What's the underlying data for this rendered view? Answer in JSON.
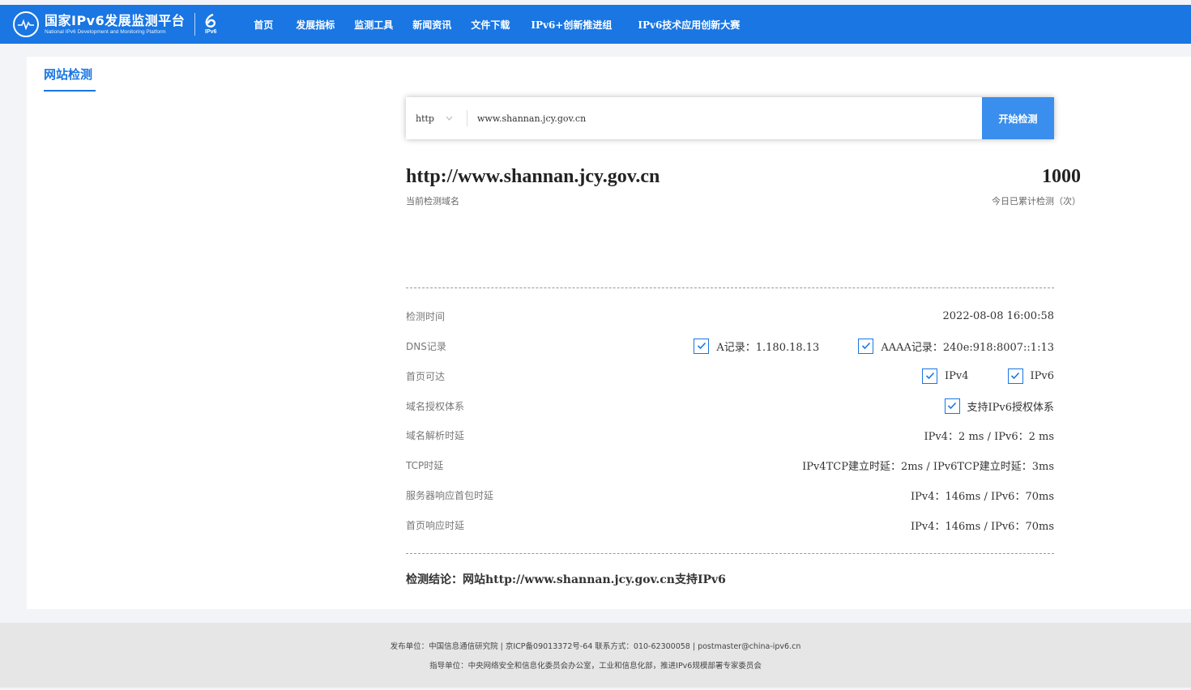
{
  "header": {
    "logo_cn": "国家IPv6发展监测平台",
    "logo_en": "National IPv6 Development and Monitoring Platform",
    "ipv6_mark": "IPv6",
    "nav": [
      "首页",
      "发展指标",
      "监测工具",
      "新闻资讯",
      "文件下载",
      "IPv6+创新推进组",
      "IPv6技术应用创新大赛"
    ]
  },
  "page": {
    "tab_title": "网站检测"
  },
  "search": {
    "protocol": "http",
    "url": "www.shannan.jcy.gov.cn",
    "button": "开始检测"
  },
  "summary": {
    "domain": "http://www.shannan.jcy.gov.cn",
    "domain_caption": "当前检测域名",
    "count": "1000",
    "count_caption": "今日已累计检测（次）"
  },
  "results": {
    "time": {
      "label": "检测时间",
      "value": "2022-08-08 16:00:58"
    },
    "dns": {
      "label": "DNS记录",
      "a": "A记录：1.180.18.13",
      "aaaa": "AAAA记录：240e:918:8007::1:13"
    },
    "reach": {
      "label": "首页可达",
      "ipv4": "IPv4",
      "ipv6": "IPv6"
    },
    "auth": {
      "label": "域名授权体系",
      "value": "支持IPv6授权体系"
    },
    "dns_latency": {
      "label": "域名解析时延",
      "value": "IPv4：2 ms / IPv6：2 ms"
    },
    "tcp": {
      "label": "TCP时延",
      "value": "IPv4TCP建立时延：2ms / IPv6TCP建立时延：3ms"
    },
    "server": {
      "label": "服务器响应首包时延",
      "value": "IPv4：146ms / IPv6：70ms"
    },
    "home": {
      "label": "首页响应时延",
      "value": "IPv4：146ms / IPv6：70ms"
    }
  },
  "conclusion": {
    "prefix": "检测结论：",
    "text": "网站http://www.shannan.jcy.gov.cn支持IPv6"
  },
  "footer": {
    "line1": "发布单位：中国信息通信研究院 | 京ICP备09013372号-64 联系方式：010-62300058 | postmaster@china-ipv6.cn",
    "line2": "指导单位：中央网络安全和信息化委员会办公室，工业和信息化部，推进IPv6规模部署专家委员会"
  },
  "colors": {
    "primary": "#1976e3",
    "button": "#3a8eed",
    "footer_bg": "#e6e6e6",
    "page_bg": "#f2f4f7"
  }
}
